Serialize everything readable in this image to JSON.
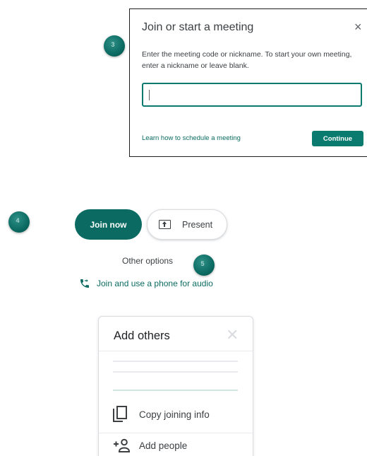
{
  "markers": [
    "3",
    "4",
    "5"
  ],
  "join_dialog": {
    "title": "Join or start a meeting",
    "close_glyph": "×",
    "description": "Enter the meeting code or nickname. To start your own meeting, enter a nickname or leave blank.",
    "input_value": "",
    "learn_link": "Learn how to schedule a meeting",
    "continue_label": "Continue"
  },
  "actions": {
    "join_label": "Join now",
    "present_label": "Present",
    "other_options": "Other options",
    "phone_label": "Join and use a phone for audio"
  },
  "add_others": {
    "title": "Add others",
    "close_glyph": "✕",
    "copy_label": "Copy joining info",
    "add_people_label": "Add people"
  },
  "colors": {
    "accent": "#0b6b62",
    "marker": "#0b6b62"
  }
}
